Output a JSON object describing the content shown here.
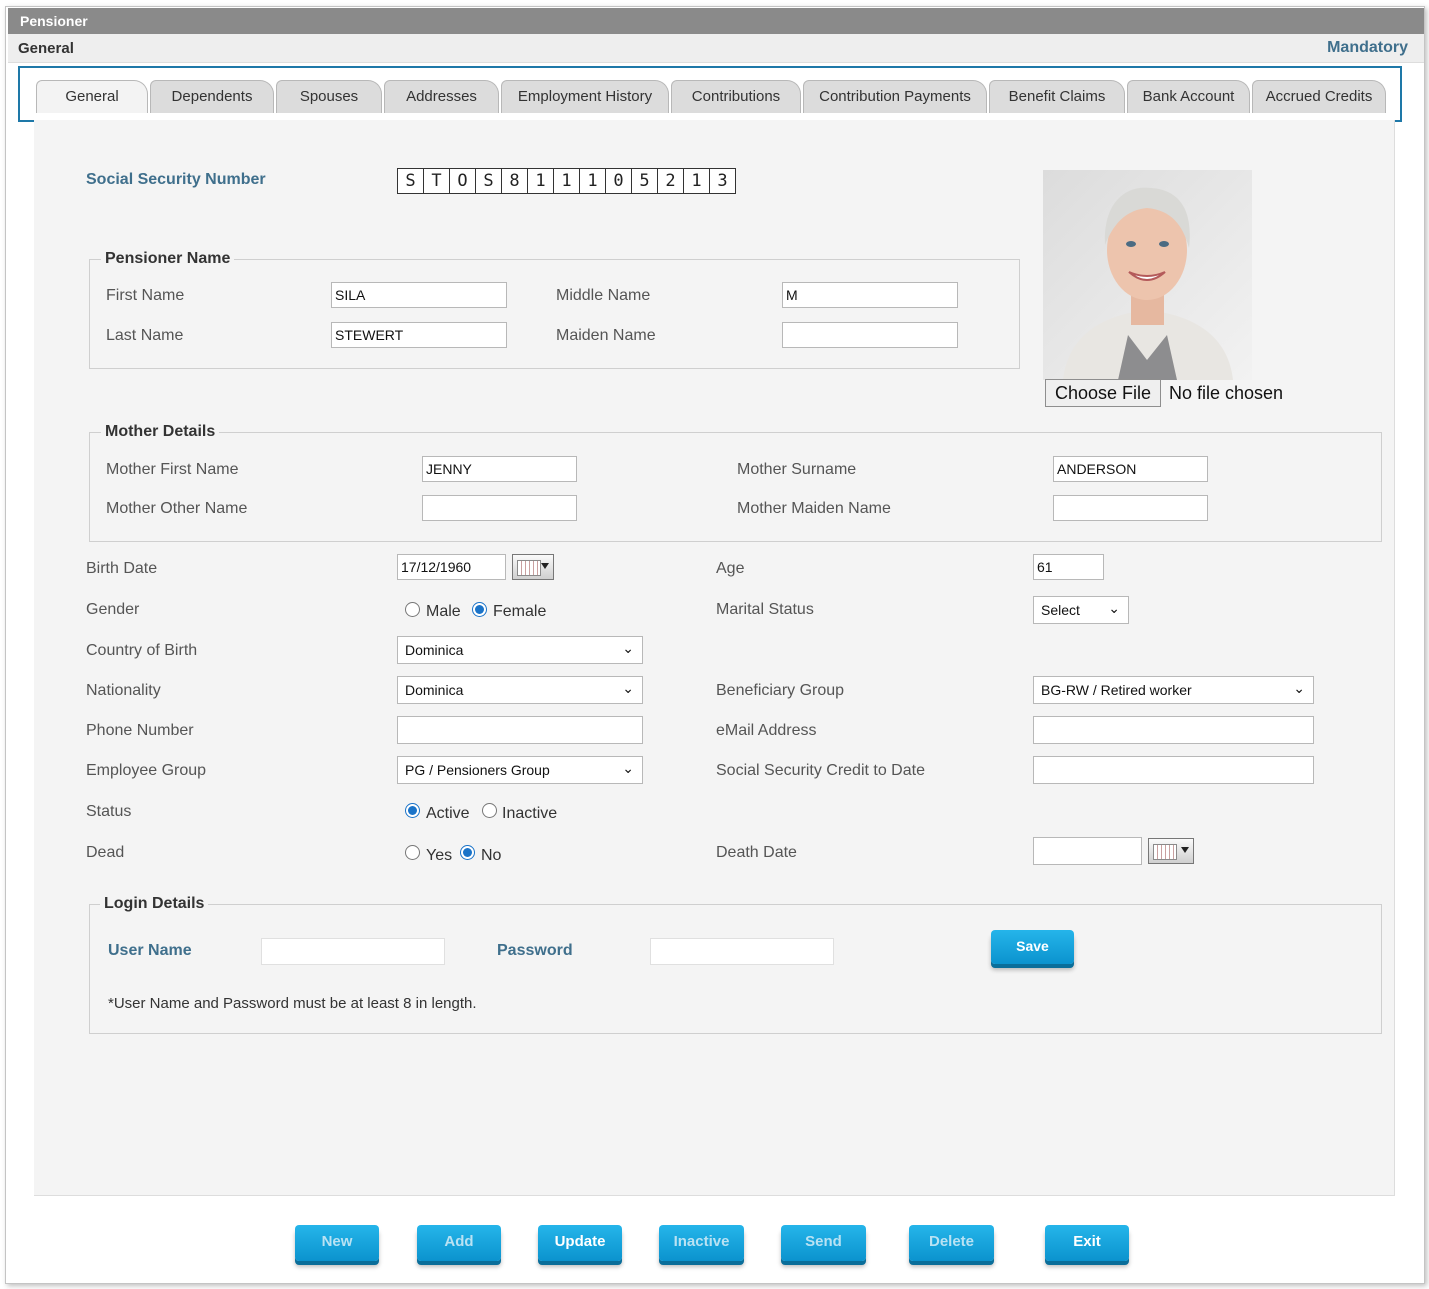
{
  "window": {
    "title": "Pensioner",
    "section": "General",
    "mandatory_label": "Mandatory"
  },
  "tabs": [
    "General",
    "Dependents",
    "Spouses",
    "Addresses",
    "Employment History",
    "Contributions",
    "Contribution Payments",
    "Benefit Claims",
    "Bank Account",
    "Accrued Credits"
  ],
  "active_tab": "General",
  "ssn": {
    "label": "Social Security Number",
    "chars": [
      "S",
      "T",
      "O",
      "S",
      "8",
      "1",
      "1",
      "1",
      "0",
      "5",
      "2",
      "1",
      "3"
    ]
  },
  "photo": {
    "choose_label": "Choose File",
    "no_file": "No file chosen"
  },
  "pensioner_name": {
    "legend": "Pensioner Name",
    "first_name_label": "First Name",
    "first_name": "SILA",
    "middle_name_label": "Middle Name",
    "middle_name": "M",
    "last_name_label": "Last Name",
    "last_name": "STEWERT",
    "maiden_name_label": "Maiden Name",
    "maiden_name": ""
  },
  "mother": {
    "legend": "Mother Details",
    "first_name_label": "Mother First Name",
    "first_name": "JENNY",
    "surname_label": "Mother Surname",
    "surname": "ANDERSON",
    "other_name_label": "Mother Other Name",
    "other_name": "",
    "maiden_name_label": "Mother Maiden Name",
    "maiden_name": ""
  },
  "details": {
    "birth_date_label": "Birth Date",
    "birth_date": "17/12/1960",
    "age_label": "Age",
    "age": "61",
    "gender_label": "Gender",
    "gender_options": [
      "Male",
      "Female"
    ],
    "gender": "Female",
    "marital_label": "Marital Status",
    "marital_value": "Select",
    "country_label": "Country of Birth",
    "country": "Dominica",
    "nationality_label": "Nationality",
    "nationality": "Dominica",
    "beneficiary_label": "Beneficiary Group",
    "beneficiary": "BG-RW / Retired worker",
    "phone_label": "Phone Number",
    "phone": "",
    "email_label": "eMail Address",
    "email": "",
    "employee_group_label": "Employee Group",
    "employee_group": "PG / Pensioners Group",
    "ss_credit_label": "Social Security Credit to Date",
    "ss_credit": "",
    "status_label": "Status",
    "status_options": [
      "Active",
      "Inactive"
    ],
    "status": "Active",
    "dead_label": "Dead",
    "dead_options": [
      "Yes",
      "No"
    ],
    "dead": "No",
    "death_date_label": "Death Date",
    "death_date": ""
  },
  "login": {
    "legend": "Login Details",
    "user_label": "User Name",
    "user": "",
    "password_label": "Password",
    "password": "",
    "save_label": "Save",
    "note": "*User Name and Password must be at least 8 in length."
  },
  "actions": [
    "New",
    "Add",
    "Update",
    "Inactive",
    "Send",
    "Delete",
    "Exit"
  ]
}
